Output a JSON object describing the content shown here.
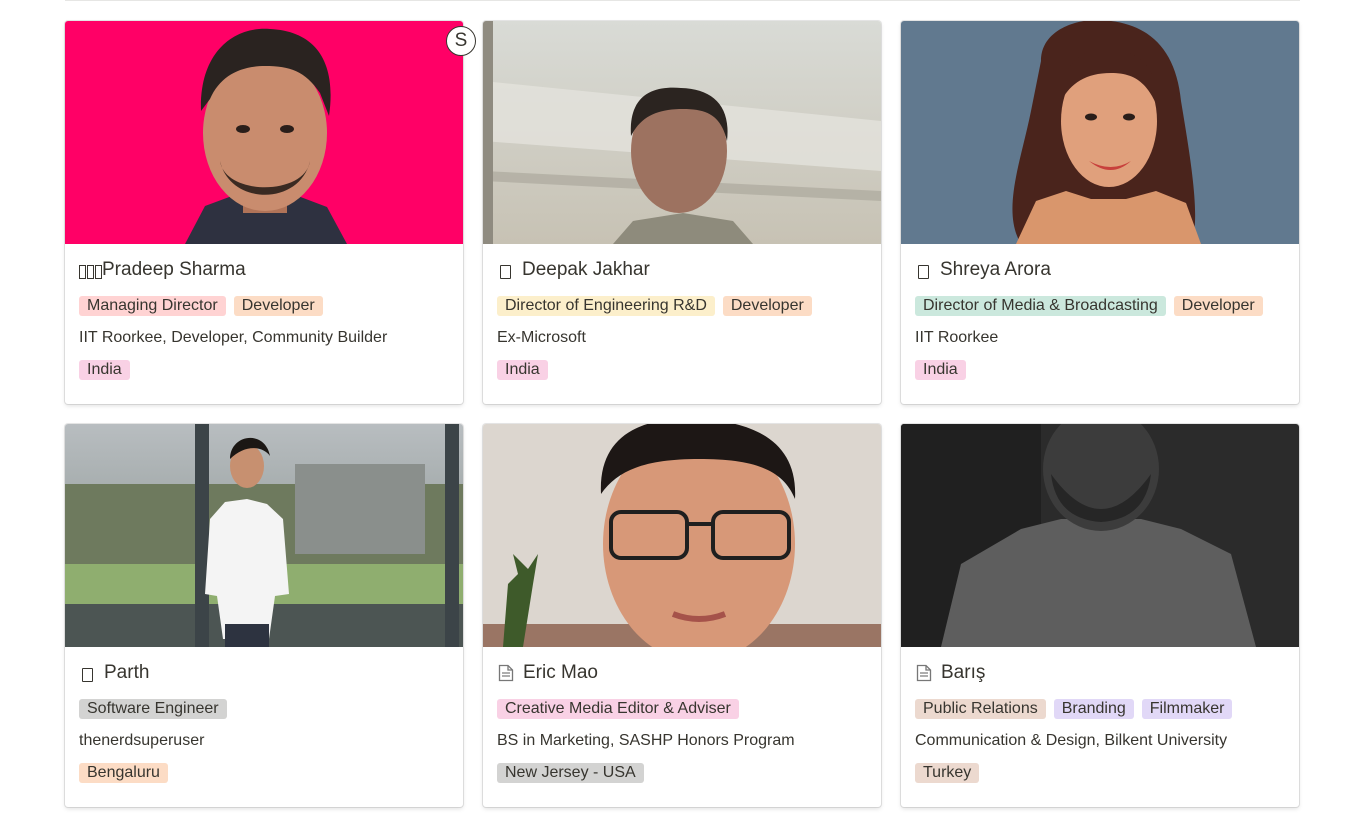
{
  "badge": {
    "initial": "S"
  },
  "cards": [
    {
      "name": "Pradeep Sharma",
      "icon": "broken-glyph-icon",
      "roles": [
        {
          "label": "Managing Director",
          "color": "#ffd3d3"
        },
        {
          "label": "Developer",
          "color": "#fcdcc5"
        }
      ],
      "description": "IIT Roorkee, Developer, Community Builder",
      "location": {
        "label": "India",
        "color": "#f9d1e5"
      }
    },
    {
      "name": "Deepak Jakhar",
      "icon": "broken-glyph-icon",
      "roles": [
        {
          "label": "Director of Engineering R&D",
          "color": "#fcefcb"
        },
        {
          "label": "Developer",
          "color": "#fcdcc5"
        }
      ],
      "description": "Ex-Microsoft",
      "location": {
        "label": "India",
        "color": "#f9d1e5"
      }
    },
    {
      "name": "Shreya Arora",
      "icon": "broken-glyph-icon",
      "roles": [
        {
          "label": "Director of Media & Broadcasting",
          "color": "#cbe8dd"
        },
        {
          "label": "Developer",
          "color": "#fcdcc5"
        }
      ],
      "description": "IIT Roorkee",
      "location": {
        "label": "India",
        "color": "#f9d1e5"
      }
    },
    {
      "name": "Parth",
      "icon": "broken-glyph-icon",
      "roles": [
        {
          "label": "Software Engineer",
          "color": "#d3d3d2"
        }
      ],
      "description": "thenerdsuperuser",
      "location": {
        "label": "Bengaluru",
        "color": "#fcdcc5"
      }
    },
    {
      "name": "Eric Mao",
      "icon": "page-icon",
      "roles": [
        {
          "label": "Creative Media Editor & Adviser",
          "color": "#f9d1e5"
        }
      ],
      "description": "BS in Marketing, SASHP Honors Program",
      "location": {
        "label": "New Jersey - USA",
        "color": "#d3d3d2"
      }
    },
    {
      "name": "Barış",
      "icon": "page-icon",
      "roles": [
        {
          "label": "Public Relations",
          "color": "#ecd9cf"
        },
        {
          "label": "Branding",
          "color": "#e1d8f7"
        },
        {
          "label": "Filmmaker",
          "color": "#e1d8f7"
        }
      ],
      "description": "Communication & Design, Bilkent University",
      "location": {
        "label": "Turkey",
        "color": "#ecd9cf"
      }
    }
  ]
}
